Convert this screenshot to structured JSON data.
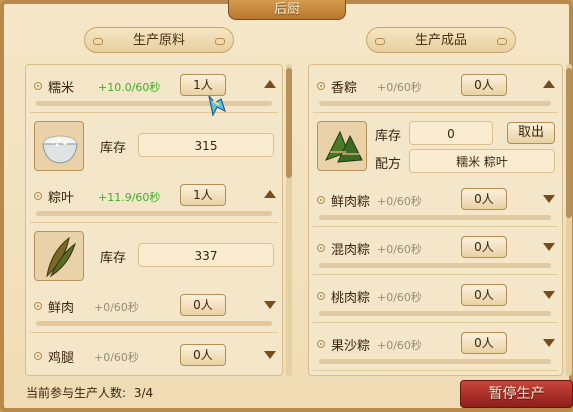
{
  "window": {
    "title": "后厨"
  },
  "left": {
    "header": "生产原料",
    "items": [
      {
        "name": "糯米",
        "rate": "+10.0/60秒",
        "workers": "1人",
        "expanded": true,
        "detail": {
          "stock_label": "库存",
          "stock": "315",
          "icon": "rice-bowl-icon"
        }
      },
      {
        "name": "粽叶",
        "rate": "+11.9/60秒",
        "workers": "1人",
        "expanded": true,
        "detail": {
          "stock_label": "库存",
          "stock": "337",
          "icon": "bamboo-leaf-icon"
        }
      },
      {
        "name": "鲜肉",
        "rate": "+0/60秒",
        "workers": "0人",
        "expanded": false
      },
      {
        "name": "鸡腿",
        "rate": "+0/60秒",
        "workers": "0人",
        "expanded": false
      }
    ]
  },
  "right": {
    "header": "生产成品",
    "items": [
      {
        "name": "香粽",
        "rate": "+0/60秒",
        "workers": "0人",
        "expanded": true,
        "detail": {
          "stock_label": "库存",
          "stock": "0",
          "take_label": "取出",
          "recipe_label": "配方",
          "recipe": "糯米 粽叶",
          "icon": "zongzi-icon"
        }
      },
      {
        "name": "鲜肉粽",
        "rate": "+0/60秒",
        "workers": "0人",
        "expanded": false
      },
      {
        "name": "混肉粽",
        "rate": "+0/60秒",
        "workers": "0人",
        "expanded": false
      },
      {
        "name": "桃肉粽",
        "rate": "+0/60秒",
        "workers": "0人",
        "expanded": false
      },
      {
        "name": "果沙粽",
        "rate": "+0/60秒",
        "workers": "0人",
        "expanded": false
      }
    ]
  },
  "footer": {
    "participants_label": "当前参与生产人数:",
    "participants_value": "3/4",
    "pause_button": "暂停生产"
  },
  "colors": {
    "active_rate": "#3fae2a",
    "idle_rate": "#9b8a73",
    "pause_button": "#b8342c"
  }
}
